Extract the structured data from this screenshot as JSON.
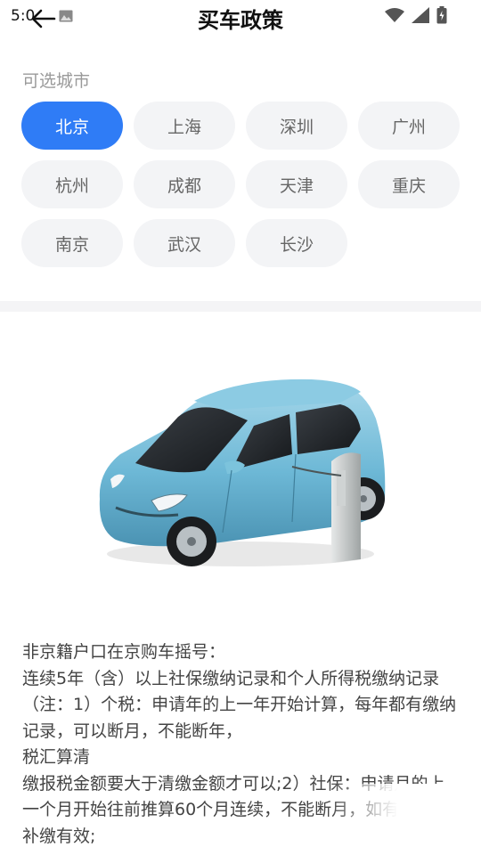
{
  "status_bar": {
    "time": "5:0"
  },
  "header": {
    "title": "买车政策"
  },
  "cities": {
    "label": "可选城市",
    "items": [
      {
        "name": "北京",
        "selected": true
      },
      {
        "name": "上海",
        "selected": false
      },
      {
        "name": "深圳",
        "selected": false
      },
      {
        "name": "广州",
        "selected": false
      },
      {
        "name": "杭州",
        "selected": false
      },
      {
        "name": "成都",
        "selected": false
      },
      {
        "name": "天津",
        "selected": false
      },
      {
        "name": "重庆",
        "selected": false
      },
      {
        "name": "南京",
        "selected": false
      },
      {
        "name": "武汉",
        "selected": false
      },
      {
        "name": "长沙",
        "selected": false
      }
    ]
  },
  "policy": {
    "lines": [
      "非京籍户口在京购车摇号：",
      "连续5年（含）以上社保缴纳记录和个人所得税缴纳记录（注：1）个税：申请年的上一年开始计算，每年都有缴纳记录，可以断月，不能断年，",
      "税汇算清",
      "缴报税金额要大于清缴金额才可以;2）社保：申请月的上一个月开始往前推算60个月连续，不能断月，如有断月，补缴有效;"
    ]
  },
  "colors": {
    "accent": "#2f7cf6",
    "chip_bg": "#f3f4f6"
  },
  "icons": [
    "back-arrow-icon",
    "image-icon",
    "wifi-icon",
    "signal-icon",
    "battery-icon",
    "electric-car-illustration"
  ]
}
